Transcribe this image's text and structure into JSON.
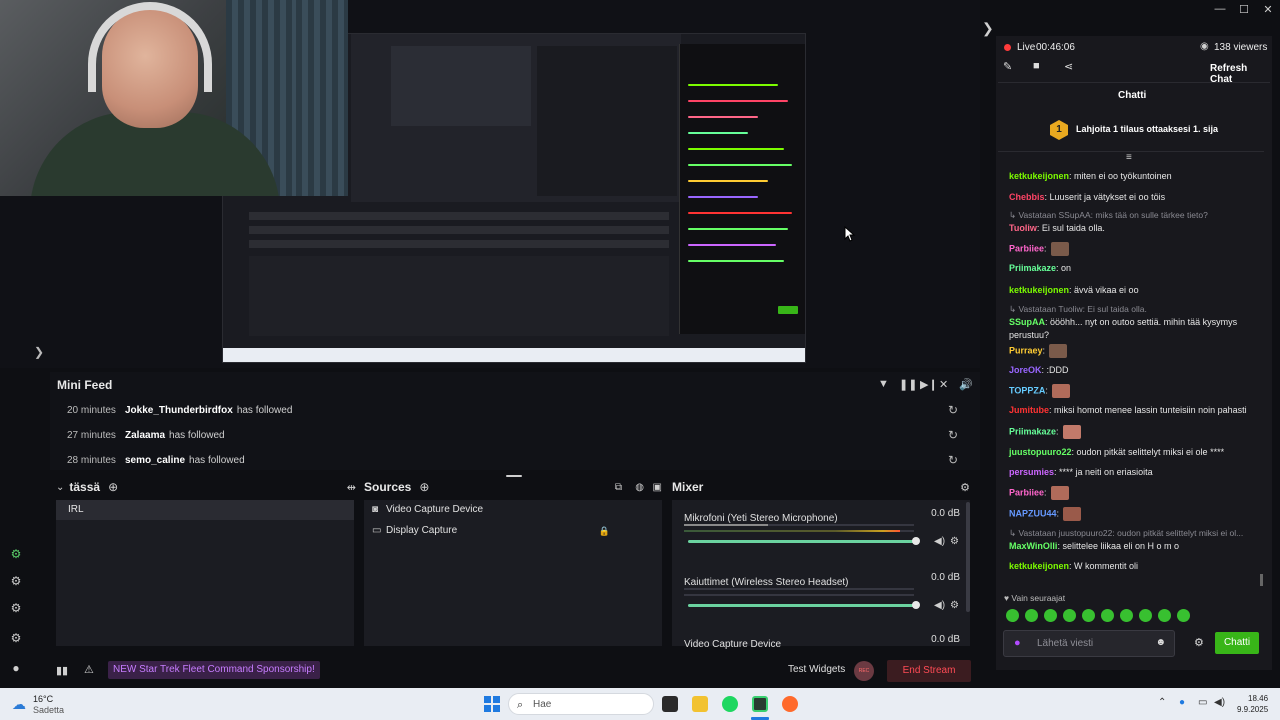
{
  "window": {
    "controls": [
      "—",
      "☐",
      "✕"
    ]
  },
  "preview": {
    "capture_label_left": "Mini Feed",
    "mini_feed_rows": [
      {
        "time": "20 minutes",
        "user": "Jokke_Thunderbirdfox",
        "action": "has followed"
      },
      {
        "time": "27 minutes",
        "user": "Zalaama",
        "action": "has followed"
      },
      {
        "time": "28 minutes",
        "user": "semo_caline",
        "action": "has followed"
      }
    ]
  },
  "mini_feed": {
    "title": "Mini Feed",
    "rows": [
      {
        "time": "20 minutes",
        "user": "Jokke_Thunderbirdfox",
        "action": "has followed"
      },
      {
        "time": "27 minutes",
        "user": "Zalaama",
        "action": "has followed"
      },
      {
        "time": "28 minutes",
        "user": "semo_caline",
        "action": "has followed"
      }
    ]
  },
  "scenes": {
    "title": "tässä",
    "items": [
      "IRL"
    ]
  },
  "sources": {
    "title": "Sources",
    "items": [
      "Video Capture Device",
      "Display Capture"
    ]
  },
  "mixer": {
    "title": "Mixer",
    "channels": [
      {
        "name": "Mikrofoni (Yeti Stereo Microphone)",
        "db": "0.0 dB"
      },
      {
        "name": "Kaiuttimet (Wireless Stereo Headset)",
        "db": "0.0 dB"
      },
      {
        "name": "Video Capture Device",
        "db": "0.0 dB"
      }
    ]
  },
  "status_bar": {
    "sponsor": "NEW Star Trek Fleet Command Sponsorship!",
    "test_widgets": "Test Widgets",
    "rec_label": "REC",
    "end_stream": "End Stream"
  },
  "chat": {
    "live_label": "Live",
    "live_time": "00:46:06",
    "viewers": "138 viewers",
    "refresh": "Refresh Chat",
    "title": "Chatti",
    "goal_rank": "1",
    "goal_text": "Lahjoita 1 tilaus ottaaksesi 1. sija",
    "messages": [
      {
        "user": "ketkukeijonen",
        "color": "#7cfc00",
        "text": ": miten ei oo työkuntoinen"
      },
      {
        "user": "Chebbis",
        "color": "#ff4466",
        "text": ": Luuserit ja vätykset ei oo töis"
      },
      {
        "reply": "Vastataan SSupAA: miks tää on sulle tärkee tieto?"
      },
      {
        "user": "Tuoliw",
        "color": "#ff6688",
        "text": ": Ei sul taida olla."
      },
      {
        "user": "Parbiiee",
        "color": "#ff66cc",
        "text": ":",
        "emote": true
      },
      {
        "user": "Priimakaze",
        "color": "#66ff99",
        "text": ": on"
      },
      {
        "user": "ketkukeijonen",
        "color": "#7cfc00",
        "text": ": ävvä vikaa ei oo"
      },
      {
        "reply": "Vastataan Tuoliw: Ei sul taida olla."
      },
      {
        "user": "SSupAA",
        "color": "#66ff66",
        "text": ": öööhh... nyt on outoo settiä. mihin tää kysymys perustuu?"
      },
      {
        "user": "Purraey",
        "color": "#ffcc33",
        "text": ":",
        "emote": true
      },
      {
        "user": "JoreOK",
        "color": "#9966ff",
        "text": ": :DDD"
      },
      {
        "user": "TOPPZA",
        "color": "#66ccff",
        "text": ":",
        "emote": true
      },
      {
        "user": "Jumitube",
        "color": "#ff3333",
        "text": ": miksi homot menee lassin tunteisiin noin pahasti"
      },
      {
        "user": "Priimakaze",
        "color": "#66ff99",
        "text": ":",
        "emote": true
      },
      {
        "user": "juustopuuro22",
        "color": "#66ff66",
        "text": ": oudon pitkät selittelyt miksi ei ole ****"
      },
      {
        "user": "persumies",
        "color": "#cc66ff",
        "text": ": **** ja neiti on eriasioita"
      },
      {
        "user": "Parbiiee",
        "color": "#ff66cc",
        "text": ":",
        "emote": true
      },
      {
        "user": "NAPZUU44",
        "color": "#6699ff",
        "text": ":",
        "emote": true
      },
      {
        "reply": "Vastataan juustopuuro22: oudon pitkät selittelyt miksi ei ol..."
      },
      {
        "user": "MaxWinOlli",
        "color": "#66ff66",
        "text": ": selittelee liikaa eli on H o m o"
      },
      {
        "user": "ketkukeijonen",
        "color": "#7cfc00",
        "text": ": W kommentit oli"
      }
    ],
    "followers_only": "Vain seuraajat",
    "input_placeholder": "Lähetä viesti",
    "send_label": "Chatti"
  },
  "taskbar": {
    "weather_temp": "16°C",
    "weather_desc": "Sadetta",
    "search_placeholder": "Hae",
    "time": "18.46",
    "date": "9.9.2025"
  }
}
